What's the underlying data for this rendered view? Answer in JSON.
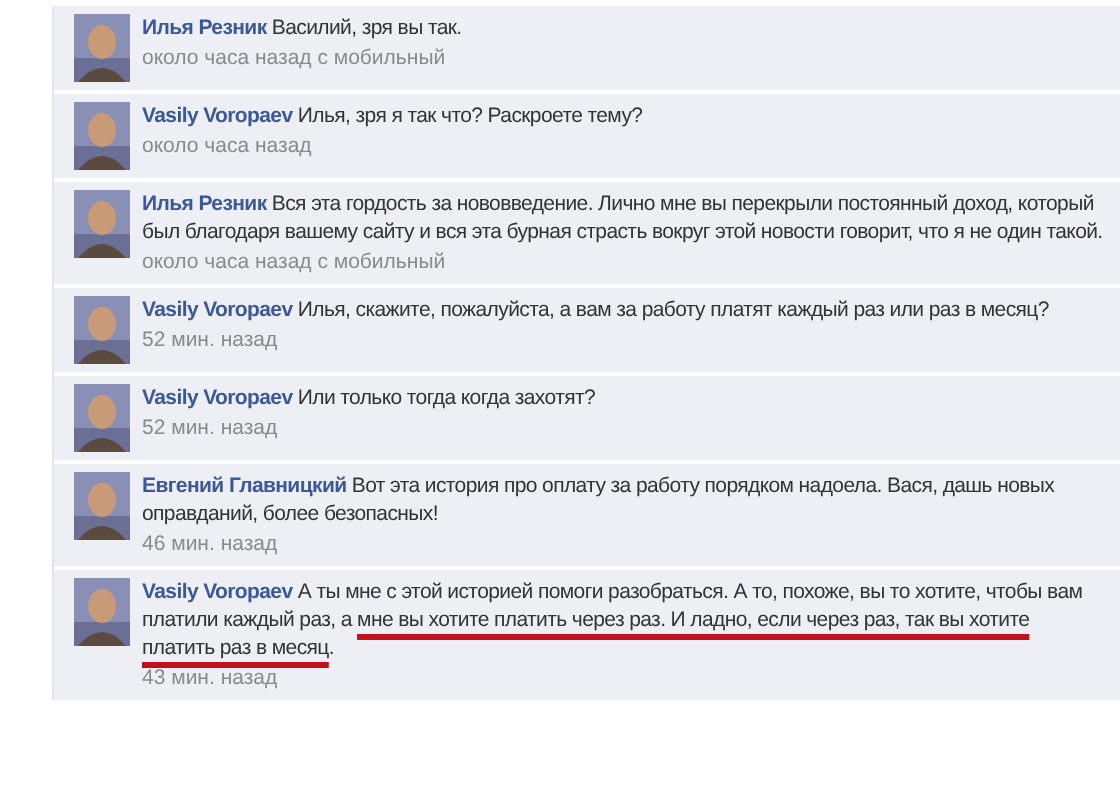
{
  "comments": [
    {
      "author": "Илья Резник",
      "text": "Василий, зря вы так.",
      "time": "около часа назад с мобильный"
    },
    {
      "author": "Vasily Voropaev",
      "text": "Илья, зря я так что? Раскроете тему?",
      "time": "около часа назад"
    },
    {
      "author": "Илья Резник",
      "text": "Вся эта гордость за нововведение. Лично мне вы перекрыли постоянный доход, который был благодаря вашему сайту и вся эта бурная страсть вокруг этой новости говорит, что я не один такой.",
      "time": "около часа назад с мобильный"
    },
    {
      "author": "Vasily Voropaev",
      "text": "Илья, скажите, пожалуйста, а вам за работу платят каждый раз или раз в месяц?",
      "time": "52 мин. назад"
    },
    {
      "author": "Vasily Voropaev",
      "text": "Или только тогда когда захотят?",
      "time": "52 мин. назад"
    },
    {
      "author": "Евгений Главницкий",
      "text": "Вот эта история про оплату за работу порядком надоела. Вася, дашь новых оправданий, более безопасных!",
      "time": "46 мин. назад"
    },
    {
      "author": "Vasily Voropaev",
      "segments": [
        {
          "text": "А ты мне с этой историей помоги разобраться. А то, похоже, вы то хотите, чтобы вам платили каждый раз, а ",
          "underlined": false
        },
        {
          "text": "мне вы хотите платить через раз. И ладно, если через раз, так вы хотите платить раз в месяц",
          "underlined": true
        },
        {
          "text": ".",
          "underlined": false
        }
      ],
      "time": "43 мин. назад"
    }
  ]
}
